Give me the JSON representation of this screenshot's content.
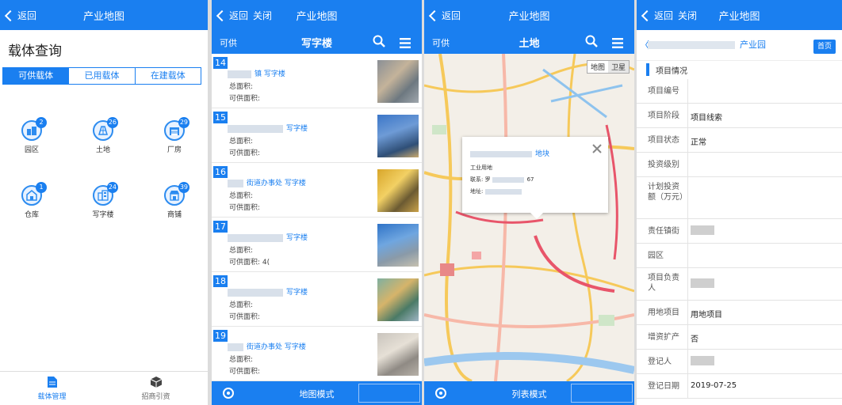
{
  "screen1": {
    "nav": {
      "back": "返回",
      "title": "产业地图"
    },
    "title": "载体查询",
    "tabs": [
      "可供载体",
      "已用载体",
      "在建载体"
    ],
    "grid": [
      {
        "label": "园区",
        "badge": "2",
        "icon": "park-icon"
      },
      {
        "label": "土地",
        "badge": "26",
        "icon": "land-icon"
      },
      {
        "label": "厂房",
        "badge": "29",
        "icon": "factory-icon"
      },
      {
        "label": "仓库",
        "badge": "1",
        "icon": "warehouse-icon"
      },
      {
        "label": "写字楼",
        "badge": "24",
        "icon": "office-building-icon"
      },
      {
        "label": "商铺",
        "badge": "39",
        "icon": "shop-icon"
      }
    ],
    "tabbar": [
      {
        "label": "载体管理",
        "icon": "document-icon",
        "active": true
      },
      {
        "label": "招商引资",
        "icon": "cube-icon",
        "active": false
      }
    ]
  },
  "screen2": {
    "nav": {
      "back": "返回",
      "close": "关闭",
      "title": "产业地图"
    },
    "sub": {
      "left": "可供",
      "title": "写字楼"
    },
    "rows": [
      {
        "num": "14",
        "name": "镇 写字楼",
        "total": "总面积:",
        "avail": "可供面积:"
      },
      {
        "num": "15",
        "name": "写字楼",
        "total": "总面积:",
        "avail": "可供面积:"
      },
      {
        "num": "16",
        "name": "街道办事处 写字楼",
        "total": "总面积:",
        "avail": "可供面积:"
      },
      {
        "num": "17",
        "name": "写字楼",
        "total": "总面积:",
        "avail": "可供面积: 4("
      },
      {
        "num": "18",
        "name": "写字楼",
        "total": "总面积:",
        "avail": "可供面积:"
      },
      {
        "num": "19",
        "name": "街道办事处 写字楼",
        "total": "总面积:",
        "avail": "可供面积:"
      }
    ],
    "bottom_mode": "地图模式"
  },
  "screen3": {
    "nav": {
      "back": "返回",
      "title": "产业地图"
    },
    "sub": {
      "left": "可供",
      "title": "土地"
    },
    "map_toggle": [
      "地图",
      "卫星"
    ],
    "popup": {
      "title": "地块",
      "type": "工业用地",
      "contact": "联系: 罗",
      "contact_tail": "67",
      "address": "地址:"
    },
    "bottom_mode": "列表模式"
  },
  "screen4": {
    "nav": {
      "back": "返回",
      "close": "关闭",
      "title": "产业地图"
    },
    "title_suffix": "产业园",
    "home": "首页",
    "section": "项目情况",
    "rows": [
      {
        "label": "项目编号",
        "value": ""
      },
      {
        "label": "项目阶段",
        "value": "项目线索"
      },
      {
        "label": "项目状态",
        "value": "正常"
      },
      {
        "label": "投资级别",
        "value": ""
      },
      {
        "label": "计划投资额（万元）",
        "value": ""
      },
      {
        "label": "责任镇街",
        "value": ""
      },
      {
        "label": "园区",
        "value": ""
      },
      {
        "label": "项目负责人",
        "value": ""
      },
      {
        "label": "用地项目",
        "value": "用地项目"
      },
      {
        "label": "增资扩产",
        "value": "否"
      },
      {
        "label": "登记人",
        "value": ""
      },
      {
        "label": "登记日期",
        "value": "2019-07-25"
      }
    ]
  }
}
